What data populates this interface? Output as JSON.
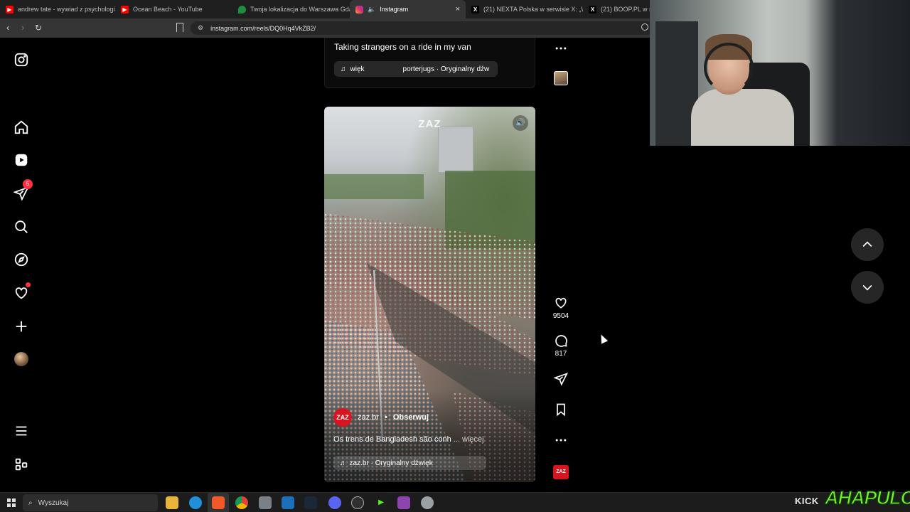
{
  "browser": {
    "tabs": [
      {
        "label": "andrew tate - wywiad z psychologiem",
        "icon": "youtube-icon",
        "active": false
      },
      {
        "label": "Ocean Beach - YouTube",
        "icon": "youtube-icon",
        "active": false
      },
      {
        "label": "Twoja lokalizacja do Warszawa Gdańs",
        "icon": "maps-pin-icon",
        "active": false
      },
      {
        "label": "Instagram",
        "icon": "instagram-icon",
        "active": true,
        "close": "×"
      },
      {
        "label": "(21) NEXTA Polska w serwisie X: „W K",
        "icon": "x-icon",
        "active": false
      },
      {
        "label": "(21) BOOP.PL w serw",
        "icon": "x-icon",
        "active": false
      }
    ],
    "url": "instagram.com/reels/DQ0Hq4VkZB2/"
  },
  "sidebar": {
    "notification_badge": "5"
  },
  "previous_reel": {
    "caption": "Taking strangers on a ride in my van",
    "audio_left": "więk",
    "audio_right": "porterjugs · Oryginalny dźw"
  },
  "reel": {
    "watermark": "ZAZ",
    "author_avatar_text": "ZAZ",
    "author": "zaz.br",
    "separator": "•",
    "follow_label": "Obserwuj",
    "caption": "Os trens de Bangladesh são conh",
    "more_label": "... więcej",
    "audio": "zaz.br · Oryginalny dźwięk"
  },
  "actions": {
    "likes": "9504",
    "comments": "817",
    "mini_avatar_text": "ZAZ"
  },
  "branding": {
    "kick": "KICK",
    "streamer": "AHAPULCO"
  },
  "taskbar": {
    "search_placeholder": "Wyszukaj"
  },
  "colors": {
    "accent_red": "#ff3040",
    "zaz_red": "#d7141f",
    "brand_green": "#7cf028"
  }
}
